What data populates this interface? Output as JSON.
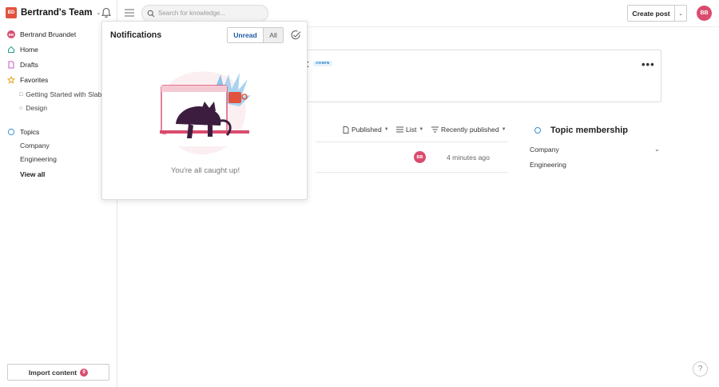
{
  "team": {
    "name": "Bertrand's Team",
    "logo_text": "BD"
  },
  "search": {
    "placeholder": "Search for knowledge..."
  },
  "toolbar": {
    "create_label": "Create post"
  },
  "user": {
    "initials": "BB"
  },
  "sidebar": {
    "user_item": {
      "label": "Bertrand Bruandet",
      "initials": "BB"
    },
    "home": "Home",
    "drafts": "Drafts",
    "favorites": "Favorites",
    "favorite_items": [
      "Getting Started with Slab",
      "Design"
    ],
    "topics": "Topics",
    "topic_items": [
      "Company",
      "Engineering"
    ],
    "view_all": "View all",
    "import_label": "Import content",
    "import_count": "9"
  },
  "profile": {
    "name_fragment": "t",
    "badge": "ADMIN"
  },
  "filters": {
    "published": "Published",
    "list": "List",
    "sort": "Recently published"
  },
  "post_row": {
    "author_initials": "BB",
    "time": "4 minutes ago"
  },
  "topic_membership": {
    "title": "Topic membership",
    "items": [
      "Company",
      "Engineering"
    ]
  },
  "notifications": {
    "title": "Notifications",
    "tab_unread": "Unread",
    "tab_all": "All",
    "empty_message": "You're all caught up!"
  },
  "help": {
    "label": "?"
  },
  "colors": {
    "accent": "#1f5aa6",
    "avatar": "#d94c6e",
    "brand": "#e0533f",
    "topic_blue": "#3a8fd9"
  }
}
